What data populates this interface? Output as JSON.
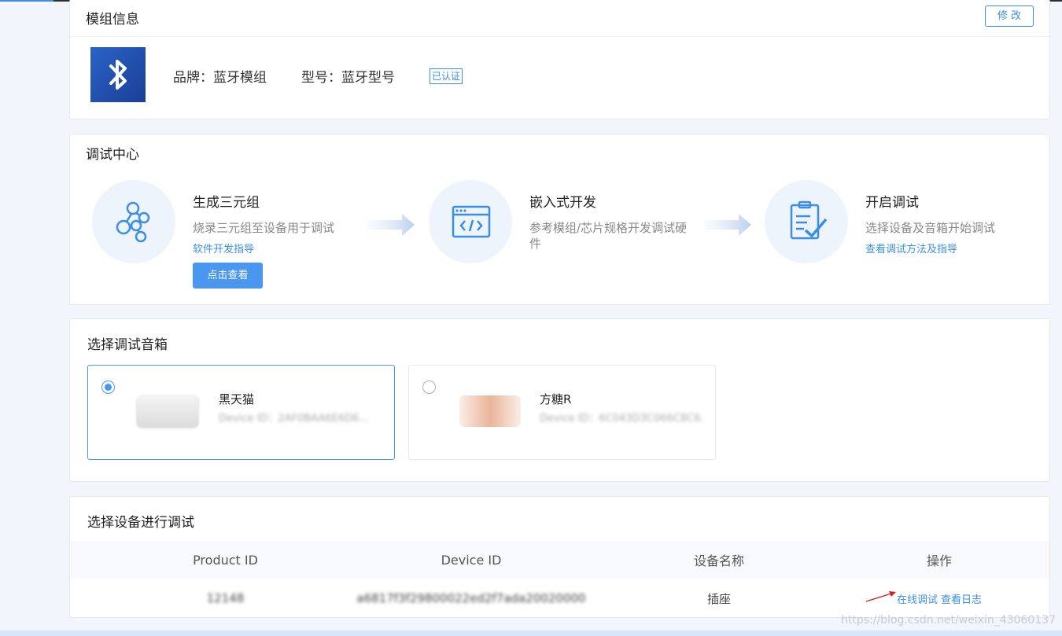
{
  "module_info": {
    "title": "模组信息",
    "edit_label": "修 改",
    "brand": "品牌：蓝牙模组",
    "model": "型号：蓝牙型号",
    "verified": "已认证",
    "logo_icon": "bluetooth-icon",
    "logo_color": "#2a5bbf"
  },
  "debug_center": {
    "title": "调试中心",
    "steps": [
      {
        "icon": "molecule-icon",
        "title": "生成三元组",
        "desc": "烧录三元组至设备用于调试",
        "link": "软件开发指导",
        "button": "点击查看"
      },
      {
        "icon": "code-window-icon",
        "title": "嵌入式开发",
        "desc": "参考模组/芯片规格开发调试硬件"
      },
      {
        "icon": "clipboard-check-icon",
        "title": "开启调试",
        "desc": "选择设备及音箱开始调试",
        "link": "查看调试方法及指导"
      }
    ]
  },
  "speaker_select": {
    "title": "选择调试音箱",
    "speakers": [
      {
        "name": "黑天猫",
        "device_id": "Device ID：2AF0BAA6E6D6...",
        "selected": true
      },
      {
        "name": "方糖R",
        "device_id": "Device ID：6C043D3C066C8C6...",
        "selected": false
      }
    ]
  },
  "device_select": {
    "title": "选择设备进行调试",
    "columns": [
      "Product ID",
      "Device ID",
      "设备名称",
      "操作"
    ],
    "rows": [
      {
        "product_id": "12148",
        "device_id": "a6817f3f29800022ed2f7ada20020000",
        "device_name": "插座",
        "actions": [
          "在线调试",
          "查看日志"
        ]
      }
    ]
  },
  "watermark": "https://blog.csdn.net/weixin_43060137",
  "colors": {
    "accent": "#3a8ee6",
    "button": "#4a97f1",
    "page_bg": "#f2f6fc",
    "annotation_arrow": "#d9211c"
  }
}
